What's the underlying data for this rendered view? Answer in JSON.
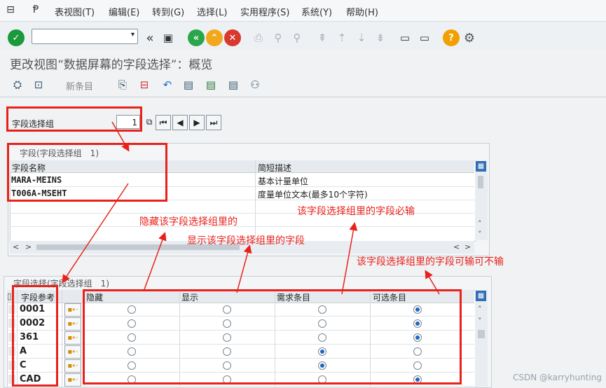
{
  "menubar": {
    "items": [
      "表视图(T)",
      "编辑(E)",
      "转到(G)",
      "选择(L)",
      "实用程序(S)",
      "系统(Y)",
      "帮助(H)"
    ]
  },
  "toolbar": {
    "command_field_value": ""
  },
  "page_title": "更改视图“数据屏幕的字段选择”：概览",
  "app_toolbar": {
    "new_entries_label": "新条目"
  },
  "field_group": {
    "label": "字段选择组",
    "value": "1"
  },
  "fields_table": {
    "caption": "字段(字段选择组　1)",
    "columns": [
      "字段名称",
      "简短描述"
    ],
    "rows": [
      {
        "name": "MARA-MEINS",
        "desc": "基本计量单位"
      },
      {
        "name": "T006A-MSEHT",
        "desc": "度量单位文本(最多10个字符)"
      }
    ]
  },
  "selection_table": {
    "caption": "字段选择(字段选择组　1)",
    "columns": [
      "字段参考",
      "隐藏",
      "显示",
      "需求条目",
      "可选条目"
    ],
    "rows": [
      {
        "ref": "0001",
        "choice": 3
      },
      {
        "ref": "0002",
        "choice": 3
      },
      {
        "ref": "361",
        "choice": 3
      },
      {
        "ref": "A",
        "choice": 2
      },
      {
        "ref": "C",
        "choice": 2
      },
      {
        "ref": "CAD",
        "choice": 3
      }
    ]
  },
  "annotations": {
    "hide": "隐藏该字段选择组里的",
    "show": "显示该字段选择组里的字段",
    "required": "该字段选择组里的字段必输",
    "optional": "该字段选择组里的字段可输可不输"
  },
  "watermark": "CSDN @karryhunting",
  "colors": {
    "annotation_red": "#e8221b",
    "check_green": "#1a9a3a",
    "radio_blue": "#1a67c0",
    "help_orange": "#f0a000"
  }
}
